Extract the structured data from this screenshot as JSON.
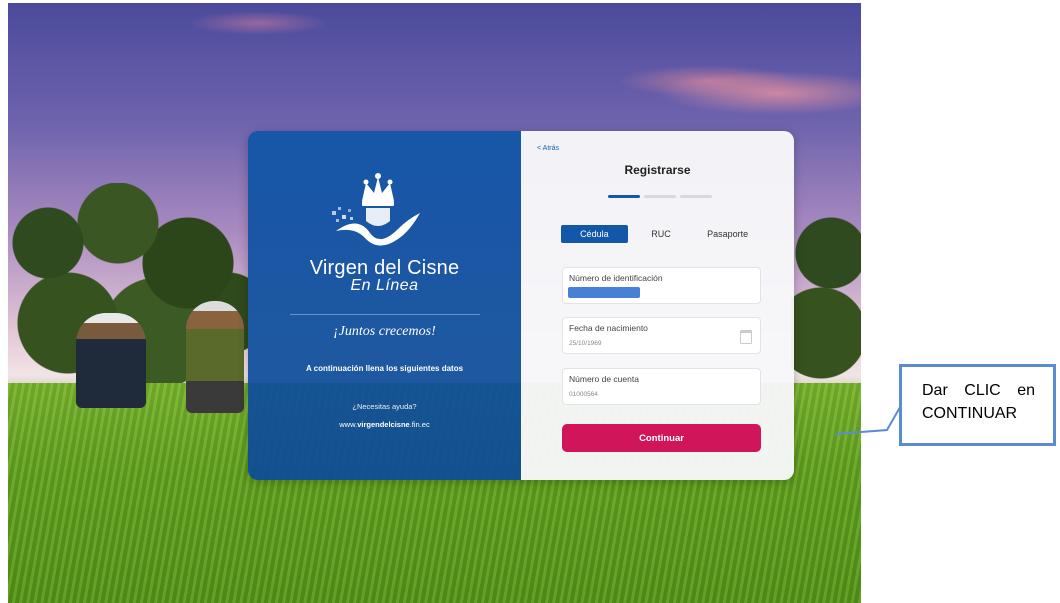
{
  "left_panel": {
    "brand_title": "Virgen del Cisne",
    "brand_subtitle": "En Línea",
    "slogan": "¡Juntos crecemos!",
    "intro": "A continuación llena los siguientes datos",
    "help": "¿Necesitas ayuda?",
    "website_prefix": "www.",
    "website_bold": "virgendelcisne",
    "website_suffix": ".fin.ec"
  },
  "form": {
    "back_label": "< Atrás",
    "title": "Registrarse",
    "steps": {
      "total": 3,
      "current": 1
    },
    "tabs": [
      {
        "label": "Cédula",
        "active": true
      },
      {
        "label": "RUC",
        "active": false
      },
      {
        "label": "Pasaporte",
        "active": false
      }
    ],
    "fields": {
      "id_number": {
        "label": "Número de identificación",
        "value": ""
      },
      "birth_date": {
        "label": "Fecha de nacimiento",
        "value": "25/10/1969"
      },
      "account_number": {
        "label": "Número de cuenta",
        "value": "01000564"
      }
    },
    "continue_label": "Continuar"
  },
  "callout": {
    "line1_word1": "Dar",
    "line1_word2": "CLIC",
    "line1_word3": "en",
    "line2": "CONTINUAR"
  },
  "colors": {
    "brand_blue": "#1257a8",
    "button_magenta": "#d0155a",
    "callout_border": "#5b8bd0"
  }
}
